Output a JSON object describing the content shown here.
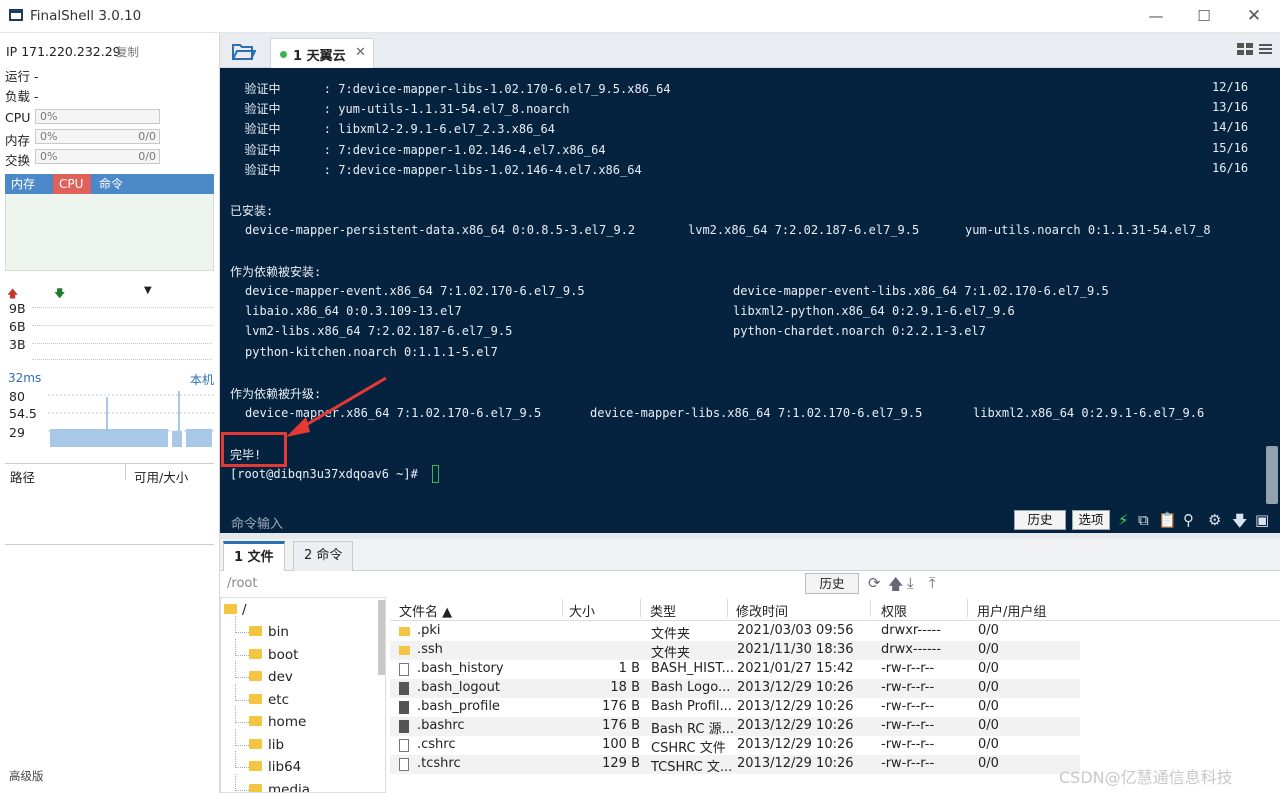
{
  "app": {
    "title": "FinalShell 3.0.10"
  },
  "window": {
    "minimize": "—",
    "maximize": "☐",
    "close": "✕"
  },
  "left": {
    "ip_label": "IP 171.220.232.29",
    "copy": "复制",
    "run": "运行 -",
    "load": "负载 -",
    "cpu": {
      "label": "CPU",
      "pct": "0%"
    },
    "mem": {
      "label": "内存",
      "pct": "0%",
      "amt": "0/0"
    },
    "swap": {
      "label": "交换",
      "pct": "0%",
      "amt": "0/0"
    },
    "tabs": [
      "内存",
      "CPU",
      "命令"
    ],
    "net_labels": [
      "9B",
      "6B",
      "3B"
    ],
    "ping": {
      "ms": "32ms",
      "host": "本机",
      "labels": [
        "80",
        "54.5",
        "29"
      ]
    },
    "path_col": "路径",
    "avail_col": "可用/大小",
    "edition": "高级版"
  },
  "session_tab": {
    "label": "1 天翼云",
    "close": "✕"
  },
  "terminal": {
    "lines": [
      {
        "col": "  验证中      : 7:device-mapper-libs-1.02.170-6.el7_9.5.x86_64",
        "prog": "12/16"
      },
      {
        "col": "  验证中      : yum-utils-1.1.31-54.el7_8.noarch",
        "prog": "13/16"
      },
      {
        "col": "  验证中      : libxml2-2.9.1-6.el7_2.3.x86_64",
        "prog": "14/16"
      },
      {
        "col": "  验证中      : 7:device-mapper-1.02.146-4.el7.x86_64",
        "prog": "15/16"
      },
      {
        "col": "  验证中      : 7:device-mapper-libs-1.02.146-4.el7.x86_64",
        "prog": "16/16"
      }
    ],
    "installed_title": "已安装:",
    "installed": [
      "device-mapper-persistent-data.x86_64 0:0.8.5-3.el7_9.2",
      "lvm2.x86_64 7:2.02.187-6.el7_9.5",
      "yum-utils.noarch 0:1.1.31-54.el7_8"
    ],
    "dep_installed_title": "作为依赖被安装:",
    "dep_installed": [
      "device-mapper-event.x86_64 7:1.02.170-6.el7_9.5",
      "device-mapper-event-libs.x86_64 7:1.02.170-6.el7_9.5",
      "libaio.x86_64 0:0.3.109-13.el7",
      "libxml2-python.x86_64 0:2.9.1-6.el7_9.6",
      "lvm2-libs.x86_64 7:2.02.187-6.el7_9.5",
      "python-chardet.noarch 0:2.2.1-3.el7",
      "python-kitchen.noarch 0:1.1.1-5.el7"
    ],
    "dep_upgraded_title": "作为依赖被升级:",
    "dep_upgraded": [
      "device-mapper.x86_64 7:1.02.170-6.el7_9.5",
      "device-mapper-libs.x86_64 7:1.02.170-6.el7_9.5",
      "libxml2.x86_64 0:2.9.1-6.el7_9.6"
    ],
    "done": "完毕!",
    "prompt": "[root@dibqn3u37xdqoav6 ~]#"
  },
  "cmdbar": {
    "label": "命令输入",
    "history": "历史",
    "options": "选项"
  },
  "file_tabs": [
    "1 文件",
    "2 命令"
  ],
  "pathbar": {
    "path": "/root",
    "history": "历史"
  },
  "tree": {
    "root": "/",
    "items": [
      "bin",
      "boot",
      "dev",
      "etc",
      "home",
      "lib",
      "lib64",
      "media"
    ]
  },
  "files": {
    "headers": [
      "文件名 ▲",
      "大小",
      "类型",
      "修改时间",
      "权限",
      "用户/用户组"
    ],
    "rows": [
      {
        "name": ".pki",
        "size": "",
        "type": "文件夹",
        "time": "2021/03/03 09:56",
        "perm": "drwxr-----",
        "own": "0/0",
        "icon": "folder"
      },
      {
        "name": ".ssh",
        "size": "",
        "type": "文件夹",
        "time": "2021/11/30 18:36",
        "perm": "drwx------",
        "own": "0/0",
        "icon": "folder"
      },
      {
        "name": ".bash_history",
        "size": "1 B",
        "type": "BASH_HIST...",
        "time": "2021/01/27 15:42",
        "perm": "-rw-r--r--",
        "own": "0/0",
        "icon": "file"
      },
      {
        "name": ".bash_logout",
        "size": "18 B",
        "type": "Bash Logo...",
        "time": "2013/12/29 10:26",
        "perm": "-rw-r--r--",
        "own": "0/0",
        "icon": "doc"
      },
      {
        "name": ".bash_profile",
        "size": "176 B",
        "type": "Bash Profil...",
        "time": "2013/12/29 10:26",
        "perm": "-rw-r--r--",
        "own": "0/0",
        "icon": "doc"
      },
      {
        "name": ".bashrc",
        "size": "176 B",
        "type": "Bash RC 源...",
        "time": "2013/12/29 10:26",
        "perm": "-rw-r--r--",
        "own": "0/0",
        "icon": "doc"
      },
      {
        "name": ".cshrc",
        "size": "100 B",
        "type": "CSHRC 文件",
        "time": "2013/12/29 10:26",
        "perm": "-rw-r--r--",
        "own": "0/0",
        "icon": "file"
      },
      {
        "name": ".tcshrc",
        "size": "129 B",
        "type": "TCSHRC 文...",
        "time": "2013/12/29 10:26",
        "perm": "-rw-r--r--",
        "own": "0/0",
        "icon": "file"
      }
    ]
  },
  "watermark": "CSDN@亿慧通信息科技",
  "colors": {
    "terminal_bg": "#05233f",
    "accent": "#4b89c8",
    "annotation": "#e53935"
  }
}
